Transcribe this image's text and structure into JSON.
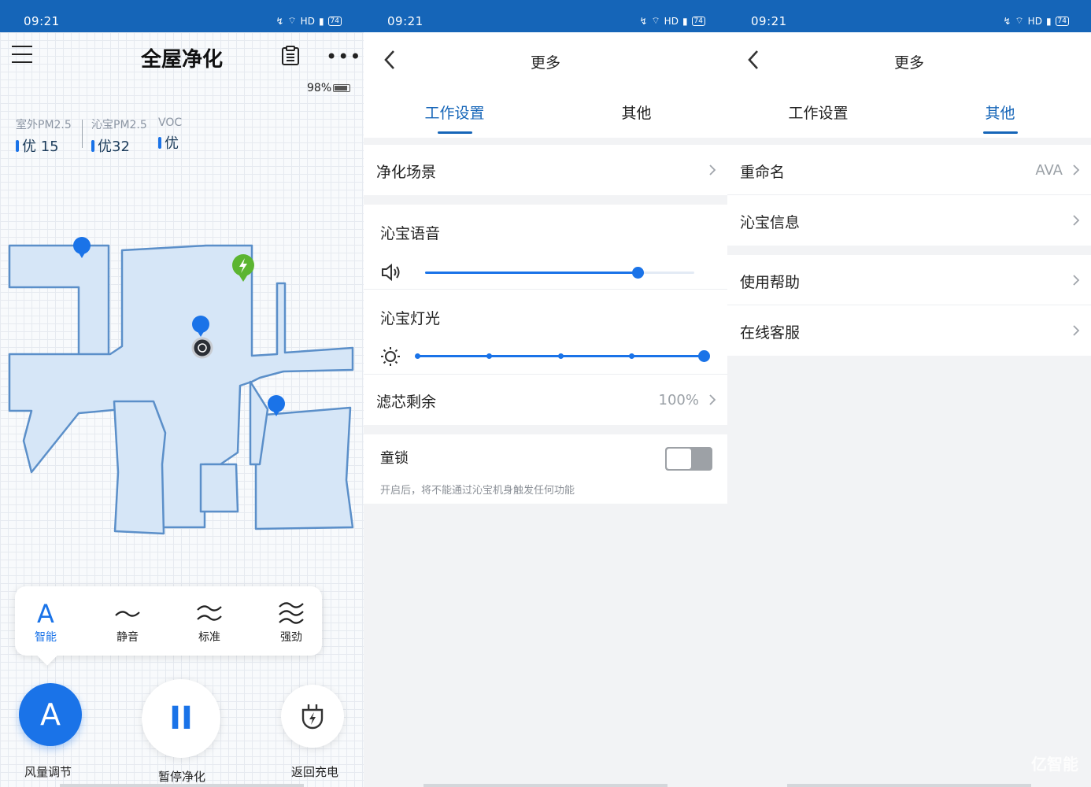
{
  "status_bar": {
    "time": "09:21",
    "network": "HD",
    "signal": "4G",
    "battery": "74"
  },
  "home": {
    "title": "全屋净化",
    "battery": "98%",
    "air_quality": [
      {
        "label": "室外PM2.5",
        "value": "优 15"
      },
      {
        "label": "沁宝PM2.5",
        "value": "优32"
      },
      {
        "label": "VOC",
        "value": "优"
      }
    ],
    "modes": [
      {
        "label": "智能",
        "icon": "letter-a-icon",
        "active": true
      },
      {
        "label": "静音",
        "icon": "wave-1-icon"
      },
      {
        "label": "标准",
        "icon": "wave-2-icon"
      },
      {
        "label": "强劲",
        "icon": "wave-3-icon"
      }
    ],
    "fan_button": {
      "glyph": "A",
      "label": "风量调节"
    },
    "pause_button": {
      "glyph": "II",
      "label": "暂停净化"
    },
    "charge_button": {
      "label": "返回充电"
    }
  },
  "more_work": {
    "back_icon": "chevron-left-icon",
    "title": "更多",
    "tabs": [
      "工作设置",
      "其他"
    ],
    "active_tab": 0,
    "scene_label": "净化场景",
    "voice_label": "沁宝语音",
    "voice_level": 0.79,
    "light_label": "沁宝灯光",
    "light_level": 1.0,
    "filter_label": "滤芯剩余",
    "filter_value": "100%",
    "child_lock_label": "童锁",
    "child_lock_on": false,
    "child_lock_hint": "开启后，将不能通过沁宝机身触发任何功能"
  },
  "more_other": {
    "title": "更多",
    "tabs": [
      "工作设置",
      "其他"
    ],
    "active_tab": 1,
    "rename_label": "重命名",
    "rename_value": "AVA",
    "info_label": "沁宝信息",
    "help_label": "使用帮助",
    "service_label": "在线客服"
  },
  "colors": {
    "brand": "#1565b8",
    "accent": "#1a73e8",
    "map_fill": "#d6e6f7",
    "map_edge": "#5b8fc9",
    "charge_pin": "#5cb531"
  },
  "watermark": "亿智能"
}
